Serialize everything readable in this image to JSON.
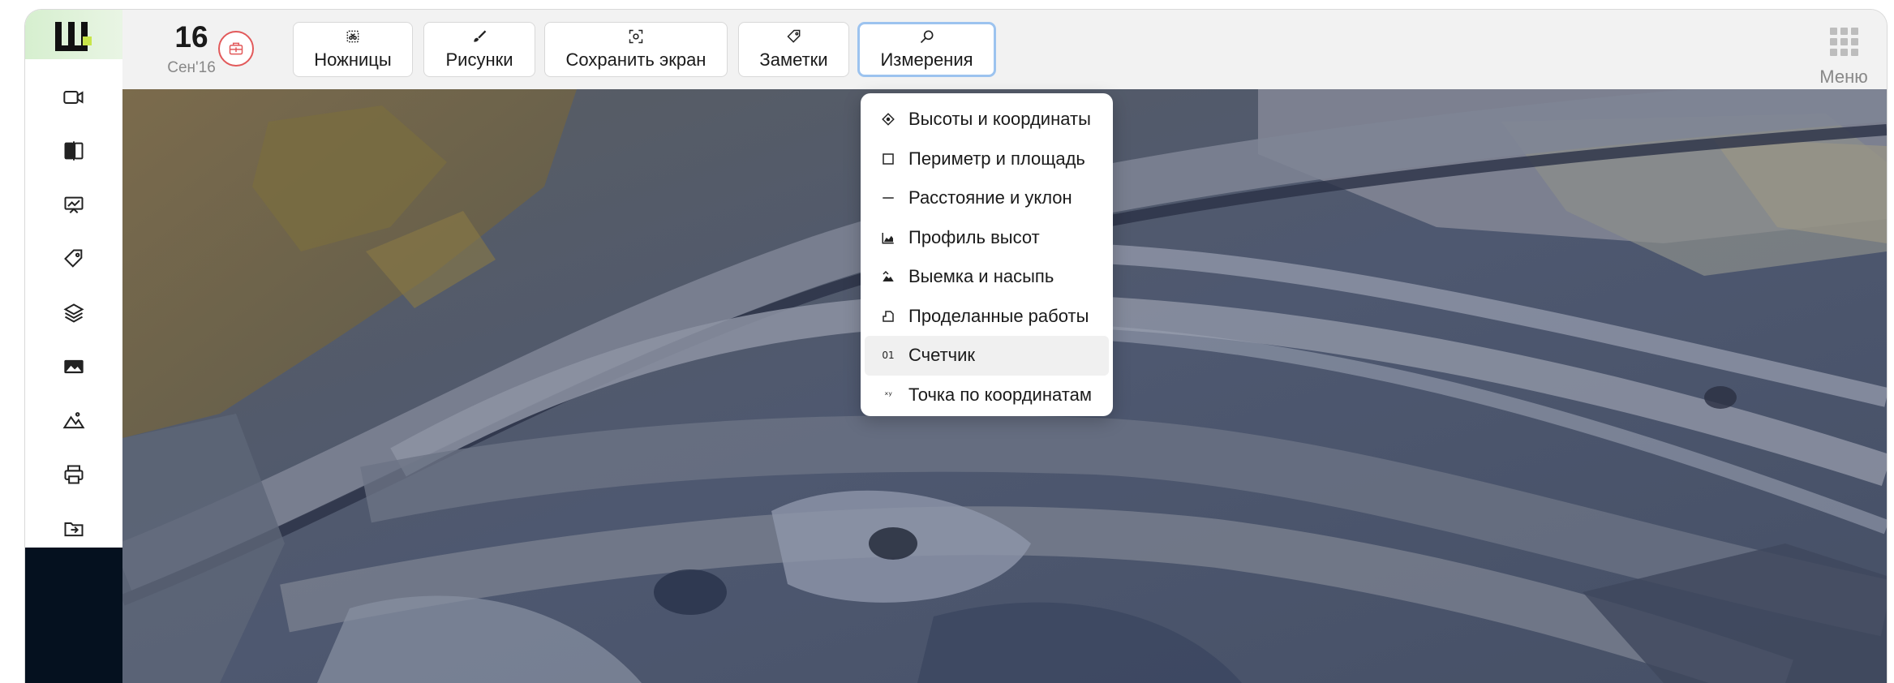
{
  "toolbar": {
    "date_day": "16",
    "date_month": "Сен'16",
    "buttons": [
      {
        "label": "Ножницы",
        "icon": "scissors-icon"
      },
      {
        "label": "Рисунки",
        "icon": "brush-icon"
      },
      {
        "label": "Сохранить экран",
        "icon": "screenshot-icon"
      },
      {
        "label": "Заметки",
        "icon": "tag-icon"
      },
      {
        "label": "Измерения",
        "icon": "measure-icon"
      }
    ],
    "active_button": "Измерения",
    "menu_label": "Меню"
  },
  "sidebar": {
    "logo_text": "Ш",
    "items": [
      {
        "icon": "video-camera-icon"
      },
      {
        "icon": "compare-icon"
      },
      {
        "icon": "presentation-chart-icon"
      },
      {
        "icon": "tag-icon"
      },
      {
        "icon": "layers-icon"
      },
      {
        "icon": "image-icon"
      },
      {
        "icon": "terrain-icon"
      },
      {
        "icon": "printer-icon"
      },
      {
        "icon": "folder-export-icon"
      }
    ]
  },
  "measure_menu": {
    "items": [
      {
        "label": "Высоты и координаты",
        "icon": "crosshair-icon"
      },
      {
        "label": "Периметр и площадь",
        "icon": "square-icon"
      },
      {
        "label": "Расстояние и уклон",
        "icon": "line-icon"
      },
      {
        "label": "Профиль высот",
        "icon": "area-chart-icon"
      },
      {
        "label": "Выемка и насыпь",
        "icon": "cut-fill-icon"
      },
      {
        "label": "Проделанные работы",
        "icon": "work-done-icon"
      },
      {
        "label": "Счетчик",
        "icon_text": "01"
      },
      {
        "label": "Точка по координатам",
        "icon_text": "ˣʸ"
      }
    ],
    "hovered_item": "Счетчик"
  },
  "colors": {
    "accent_logo": "#c8e64a",
    "active_border": "#9cc3ef",
    "camera_red": "#e2595a",
    "sidebar_footer": "#05111f"
  }
}
